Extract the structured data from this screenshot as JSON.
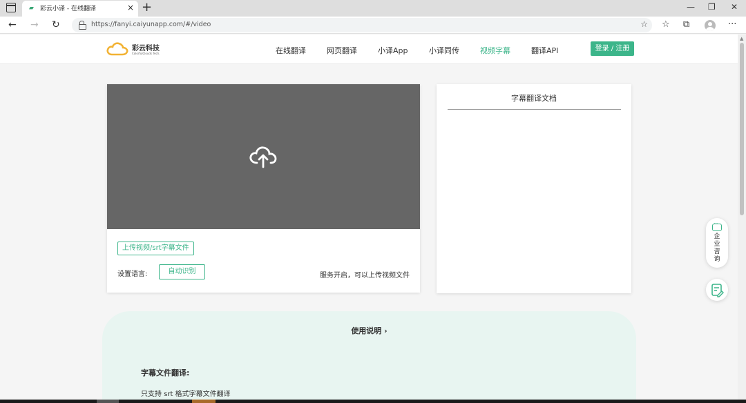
{
  "browser": {
    "tab_title": "彩云小译 - 在线翻译",
    "tab_close": "×",
    "new_tab": "+",
    "url": "https://fanyi.caiyunapp.com/#/video",
    "window_controls": {
      "minimize": "—",
      "restore": "❐",
      "close": "✕"
    },
    "nav": {
      "back": "←",
      "forward": "→",
      "refresh": "↻"
    },
    "toolbar_icons": [
      "star-add-icon",
      "favorites-icon",
      "collections-icon",
      "profile-icon",
      "more-icon"
    ],
    "more": "···"
  },
  "site": {
    "logo_name": "彩云科技",
    "logo_sub": "ColorfulClouds Tech.",
    "nav": [
      "在线翻译",
      "网页翻译",
      "小译App",
      "小译同传",
      "视频字幕",
      "翻译API"
    ],
    "active_nav": "视频字幕",
    "login": "登录 / 注册",
    "accent_color": "#3cb58a"
  },
  "upload": {
    "button": "上传视频/srt字幕文件",
    "lang_label": "设置语言:",
    "lang_value": "自动识别",
    "status": "服务开启，可以上传视频文件",
    "upload_area_color": "#666666"
  },
  "doc": {
    "title": "字幕翻译文档",
    "content": ""
  },
  "float": {
    "consult_label": "企业咨询"
  },
  "instructions": {
    "link": "使用说明 ›",
    "heading": "字幕文件翻译:",
    "text": "只支持 srt 格式字幕文件翻译"
  }
}
